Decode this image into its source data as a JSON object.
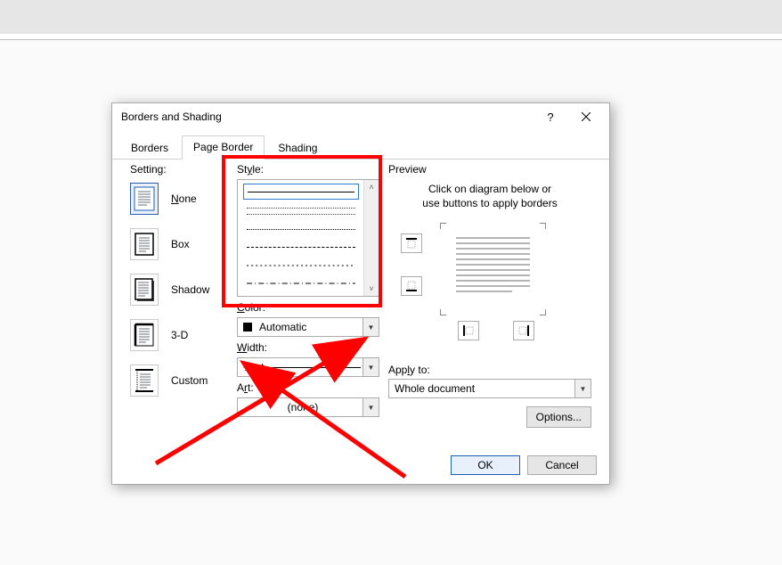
{
  "dialog": {
    "title": "Borders and Shading",
    "tabs": [
      "Borders",
      "Page Border",
      "Shading"
    ],
    "active_tab": 1
  },
  "setting": {
    "label": "Setting:",
    "items": [
      {
        "label": "None",
        "accel": 0
      },
      {
        "label": "Box",
        "accel": -1
      },
      {
        "label": "Shadow",
        "accel": -1
      },
      {
        "label": "3-D",
        "accel": -1
      },
      {
        "label": "Custom",
        "accel": -1
      }
    ],
    "selected": 0
  },
  "style": {
    "label": "Style:",
    "color_label": "Color:",
    "color_value": "Automatic",
    "width_label": "Width:",
    "width_value": "½ pt",
    "art_label": "Art:",
    "art_value": "(none)"
  },
  "preview": {
    "label": "Preview",
    "help1": "Click on diagram below or",
    "help2": "use buttons to apply borders",
    "apply_label": "Apply to:",
    "apply_value": "Whole document",
    "options_label": "Options..."
  },
  "footer": {
    "ok": "OK",
    "cancel": "Cancel"
  }
}
